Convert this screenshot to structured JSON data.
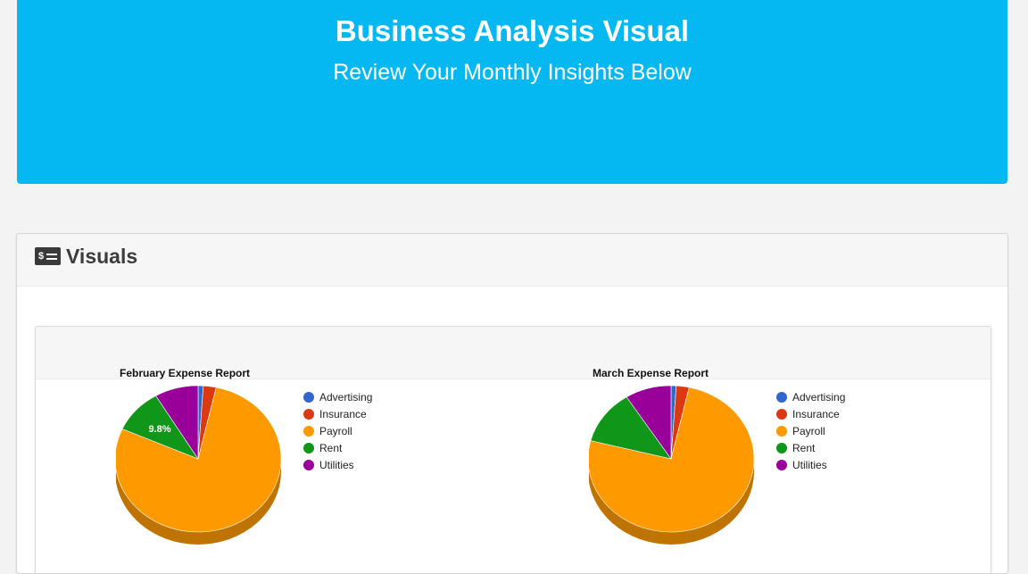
{
  "header": {
    "title": "Business Analysis Visual",
    "subtitle": "Review Your Monthly Insights Below",
    "background": "#06b8f1"
  },
  "panel": {
    "title": "Visuals",
    "icon": "money-bill-icon"
  },
  "chart_data": [
    {
      "type": "pie",
      "title": "February Expense Report",
      "categories": [
        "Advertising",
        "Insurance",
        "Payroll",
        "Rent",
        "Utilities"
      ],
      "values": [
        1.0,
        2.5,
        78.2,
        9.8,
        8.5
      ],
      "slice_labels": [
        "",
        "",
        "",
        "9.8%",
        ""
      ],
      "colors": [
        "#3366cc",
        "#dc3912",
        "#ff9900",
        "#109618",
        "#990099"
      ],
      "legend_position": "right",
      "style": "3d"
    },
    {
      "type": "pie",
      "title": "March Expense Report",
      "categories": [
        "Advertising",
        "Insurance",
        "Payroll",
        "Rent",
        "Utilities"
      ],
      "values": [
        1.0,
        2.5,
        75.5,
        12.0,
        9.0
      ],
      "slice_labels": [
        "",
        "",
        "",
        "",
        ""
      ],
      "colors": [
        "#3366cc",
        "#dc3912",
        "#ff9900",
        "#109618",
        "#990099"
      ],
      "legend_position": "right",
      "style": "3d"
    }
  ]
}
